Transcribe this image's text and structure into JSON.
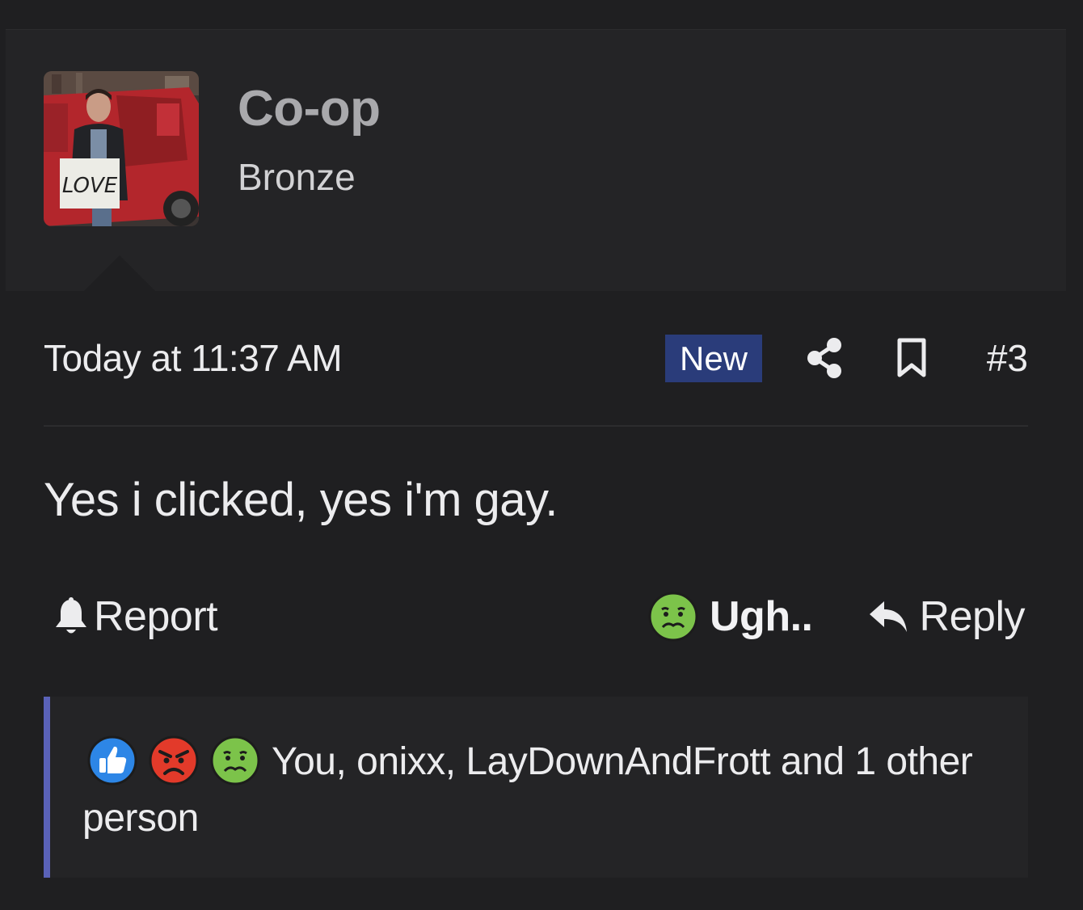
{
  "author": {
    "name": "Co-op",
    "title": "Bronze",
    "avatar_icon": "user-avatar-photo"
  },
  "meta": {
    "date": "Today at 11:37 AM",
    "badge": "New",
    "share_icon": "share-icon",
    "bookmark_icon": "bookmark-icon",
    "post_number": "#3"
  },
  "post": {
    "body": "Yes i clicked, yes i'm gay."
  },
  "actions": {
    "report_label": "Report",
    "report_icon": "bell-icon",
    "reaction_label": "Ugh..",
    "reaction_icon": "nauseated-face-icon",
    "reply_label": "Reply",
    "reply_icon": "reply-arrow-icon"
  },
  "reactions": {
    "icons": [
      "thumbs-up-icon",
      "angry-face-icon",
      "nauseated-face-icon"
    ],
    "names": "You, onixx, LayDownAndFrott and 1 other person"
  },
  "colors": {
    "background": "#1f1f21",
    "panel": "#242426",
    "badge": "#2a3c7a",
    "accent_bar": "#5a62b8",
    "like_blue": "#2d86e6",
    "angry_red": "#e23a2a",
    "nauseated_green": "#7cc34a"
  }
}
